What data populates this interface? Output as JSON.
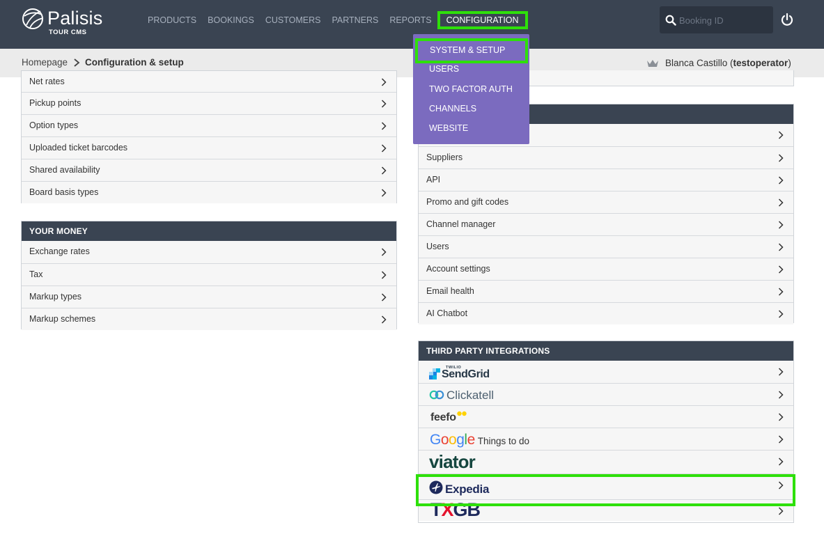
{
  "app": {
    "logo_name": "Palisis",
    "logo_sub": "TOUR CMS"
  },
  "nav": [
    {
      "label": "PRODUCTS"
    },
    {
      "label": "BOOKINGS"
    },
    {
      "label": "CUSTOMERS"
    },
    {
      "label": "PARTNERS"
    },
    {
      "label": "REPORTS"
    },
    {
      "label": "CONFIGURATION"
    }
  ],
  "search": {
    "placeholder": "Booking ID"
  },
  "breadcrumb": {
    "home": "Homepage",
    "current": "Configuration & setup"
  },
  "user": {
    "name": "Blanca Castillo",
    "account": "testoperator"
  },
  "dropdown": {
    "items": [
      {
        "label": "SYSTEM & SETUP"
      },
      {
        "label": "USERS"
      },
      {
        "label": "TWO FACTOR AUTH"
      },
      {
        "label": "CHANNELS"
      },
      {
        "label": "WEBSITE"
      }
    ]
  },
  "left_top": {
    "items": [
      {
        "label": "Net rates"
      },
      {
        "label": "Pickup points"
      },
      {
        "label": "Option types"
      },
      {
        "label": "Uploaded ticket barcodes"
      },
      {
        "label": "Shared availability"
      },
      {
        "label": "Board basis types"
      }
    ]
  },
  "your_money": {
    "title": "YOUR MONEY",
    "items": [
      {
        "label": "Exchange rates"
      },
      {
        "label": "Tax"
      },
      {
        "label": "Markup types"
      },
      {
        "label": "Markup schemes"
      }
    ]
  },
  "right_mid": {
    "items": [
      {
        "label": ""
      },
      {
        "label": "Suppliers"
      },
      {
        "label": "API"
      },
      {
        "label": "Promo and gift codes"
      },
      {
        "label": "Channel manager"
      },
      {
        "label": "Users"
      },
      {
        "label": "Account settings"
      },
      {
        "label": "Email health"
      },
      {
        "label": "AI Chatbot"
      }
    ]
  },
  "integrations": {
    "title": "THIRD PARTY INTEGRATIONS",
    "sendgrid": {
      "top": "TWILIO",
      "name": "SendGrid"
    },
    "clickatell": {
      "name": "Clickatell"
    },
    "feefo": {
      "name": "feefo"
    },
    "google": {
      "g1": "G",
      "g2": "o",
      "g3": "o",
      "g4": "g",
      "g5": "l",
      "g6": "e",
      "suffix": "Things to do"
    },
    "viator": {
      "name": "viator"
    },
    "expedia": {
      "name": "Expedia"
    },
    "txgb": {
      "t": "T",
      "x": "X",
      "gb": "GB"
    }
  },
  "colors": {
    "topbar": "#3a4452",
    "dropdown": "#7b6bbf",
    "highlight": "#2ee00a"
  }
}
